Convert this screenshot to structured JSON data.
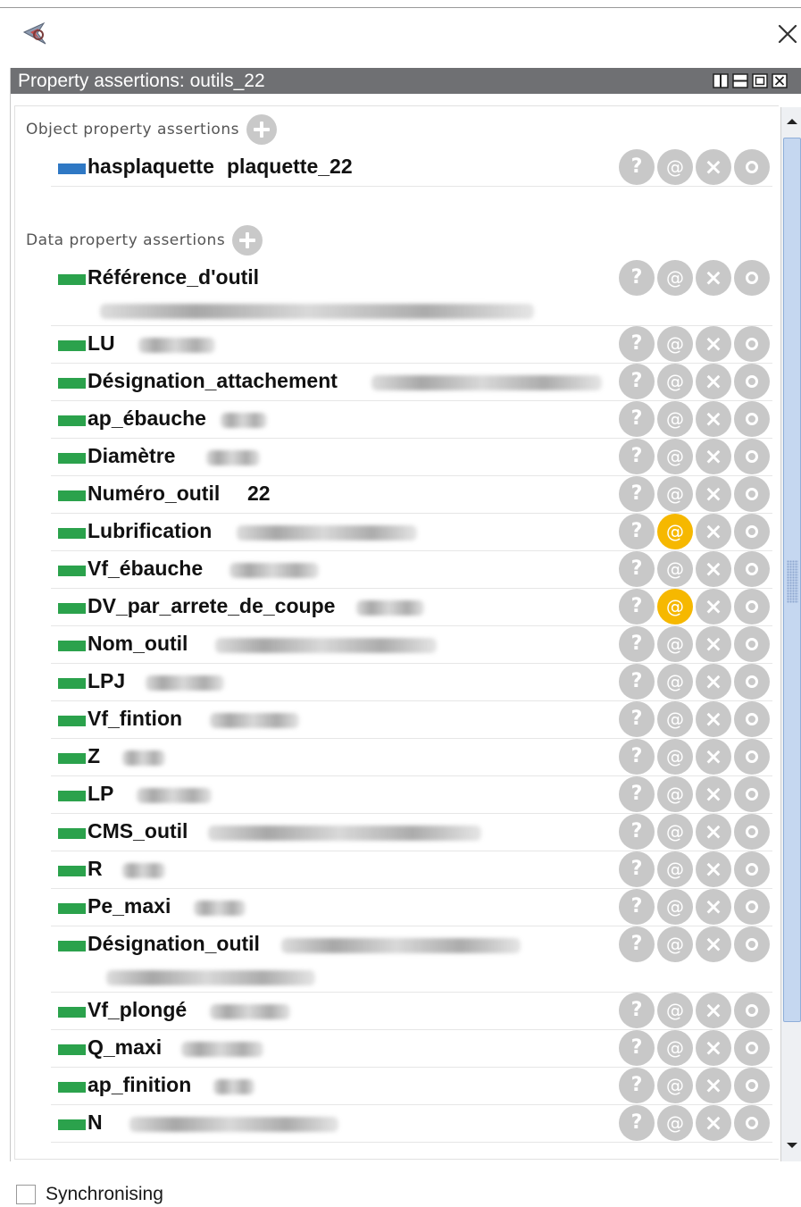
{
  "window": {
    "logo_icon": "protege-logo-icon",
    "close_icon": "close-icon"
  },
  "panel": {
    "title": "Property assertions: outils_22",
    "header_buttons": [
      "split-vertical-icon",
      "split-horizontal-icon",
      "maximize-icon",
      "close-view-icon"
    ]
  },
  "colors": {
    "object_property": "#2f78c4",
    "data_property": "#2ba24c",
    "action_inactive": "#c8c8c8",
    "action_highlight": "#f6b800",
    "header_bg": "#6f7073"
  },
  "actions": {
    "annotate": "?",
    "explain": "@",
    "delete": "×",
    "edit": "o",
    "icons": [
      "annotate-icon",
      "explain-at-icon",
      "delete-icon",
      "edit-icon"
    ]
  },
  "object_section": {
    "label": "Object property assertions",
    "assertions": [
      {
        "property": "hasplaquette",
        "value": "plaquette_22",
        "explain_highlighted": false
      }
    ]
  },
  "data_section": {
    "label": "Data property assertions",
    "assertions": [
      {
        "property": "Référence_d'outil",
        "value": "",
        "value_obscured": true,
        "explain_highlighted": false
      },
      {
        "property": "LU",
        "value": "",
        "value_obscured": true,
        "explain_highlighted": false
      },
      {
        "property": "Désignation_attachement",
        "value": "",
        "value_obscured": true,
        "explain_highlighted": false
      },
      {
        "property": "ap_ébauche",
        "value": "",
        "value_obscured": true,
        "explain_highlighted": false
      },
      {
        "property": "Diamètre",
        "value": "",
        "value_obscured": true,
        "explain_highlighted": false
      },
      {
        "property": "Numéro_outil",
        "value": "22",
        "value_obscured": false,
        "explain_highlighted": false
      },
      {
        "property": "Lubrification",
        "value": "",
        "value_obscured": true,
        "explain_highlighted": true
      },
      {
        "property": "Vf_ébauche",
        "value": "",
        "value_obscured": true,
        "explain_highlighted": false
      },
      {
        "property": "DV_par_arrete_de_coupe",
        "value": "",
        "value_obscured": true,
        "explain_highlighted": true
      },
      {
        "property": "Nom_outil",
        "value": "",
        "value_obscured": true,
        "explain_highlighted": false
      },
      {
        "property": "LPJ",
        "value": "",
        "value_obscured": true,
        "explain_highlighted": false
      },
      {
        "property": "Vf_fintion",
        "value": "",
        "value_obscured": true,
        "explain_highlighted": false
      },
      {
        "property": "Z",
        "value": "",
        "value_obscured": true,
        "explain_highlighted": false
      },
      {
        "property": "LP",
        "value": "",
        "value_obscured": true,
        "explain_highlighted": false
      },
      {
        "property": "CMS_outil",
        "value": "",
        "value_obscured": true,
        "explain_highlighted": false
      },
      {
        "property": "R",
        "value": "",
        "value_obscured": true,
        "explain_highlighted": false
      },
      {
        "property": "Pe_maxi",
        "value": "",
        "value_obscured": true,
        "explain_highlighted": false
      },
      {
        "property": "Désignation_outil",
        "value": "",
        "value_obscured": true,
        "explain_highlighted": false
      },
      {
        "property": "Vf_plongé",
        "value": "",
        "value_obscured": true,
        "explain_highlighted": false
      },
      {
        "property": "Q_maxi",
        "value": "",
        "value_obscured": true,
        "explain_highlighted": false
      },
      {
        "property": "ap_finition",
        "value": "",
        "value_obscured": true,
        "explain_highlighted": false
      },
      {
        "property": "N",
        "value": "",
        "value_obscured": true,
        "explain_highlighted": false
      }
    ]
  },
  "footer": {
    "synchronising_label": "Synchronising",
    "synchronising_checked": false
  }
}
